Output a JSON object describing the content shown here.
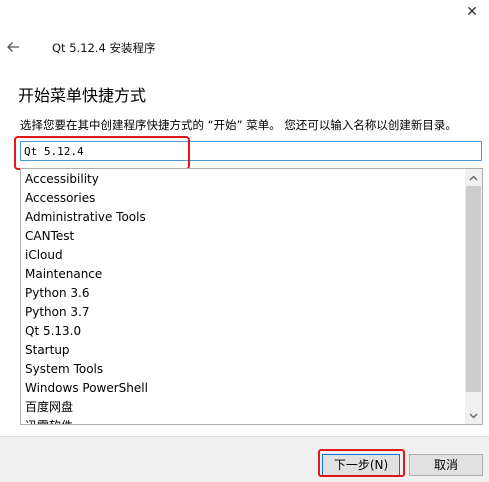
{
  "window": {
    "title": "Qt 5.12.4 安装程序",
    "close_symbol": "✕",
    "back_icon": "arrow-left-icon"
  },
  "page": {
    "title": "开始菜单快捷方式",
    "instruction": "选择您要在其中创建程序快捷方式的 “开始” 菜单。 您还可以输入名称以创建新目录。"
  },
  "folder_input": {
    "value": "Qt 5.12.4"
  },
  "folder_list": {
    "items": [
      "Accessibility",
      "Accessories",
      "Administrative Tools",
      "CANTest",
      "iCloud",
      "Maintenance",
      "Python 3.6",
      "Python 3.7",
      "Qt 5.13.0",
      "Startup",
      "System Tools",
      "Windows PowerShell",
      "百度网盘",
      "迅雷软件"
    ]
  },
  "buttons": {
    "next_label": "下一步(N)",
    "cancel_label": "取消"
  },
  "colors": {
    "annotation_red": "#e01818",
    "focus_blue": "#0078d7",
    "footer_bg": "#f0f0f0"
  }
}
